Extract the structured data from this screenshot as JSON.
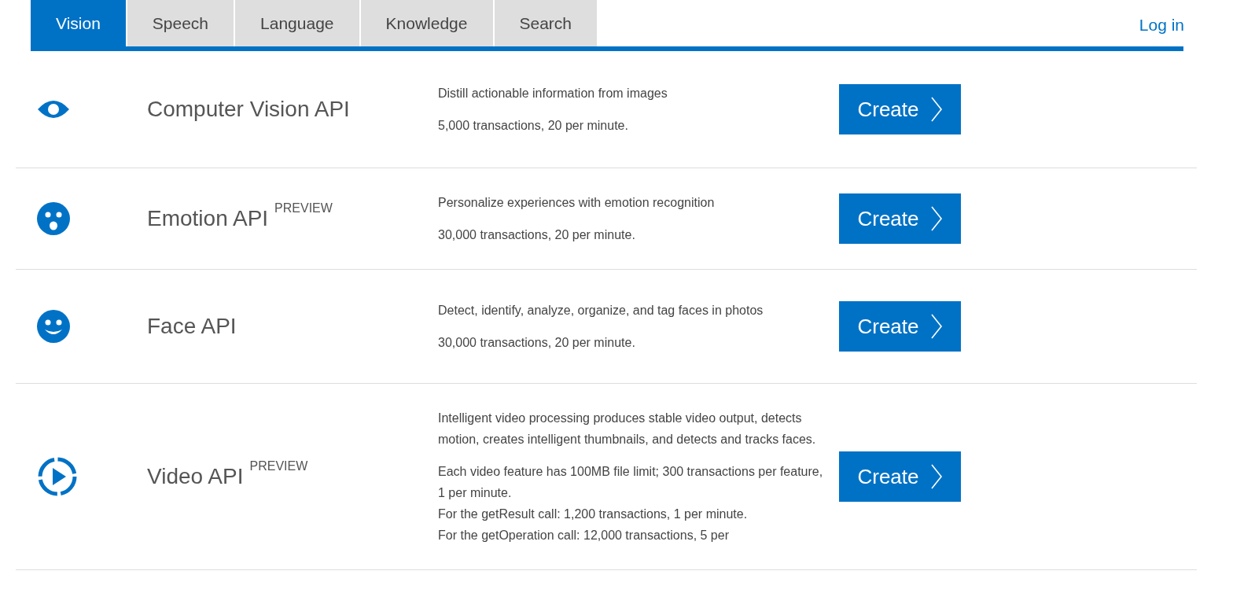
{
  "tabs": [
    {
      "label": "Vision",
      "selected": true
    },
    {
      "label": "Speech",
      "selected": false
    },
    {
      "label": "Language",
      "selected": false
    },
    {
      "label": "Knowledge",
      "selected": false
    },
    {
      "label": "Search",
      "selected": false
    }
  ],
  "login": "Log in",
  "apis": [
    {
      "kind": "eye",
      "name": "Computer Vision API",
      "description": "Distill actionable information from images",
      "limits": [
        "5,000 transactions, 20 per minute."
      ],
      "button": "Create"
    },
    {
      "kind": "emotion",
      "name": "Emotion API",
      "badge": "PREVIEW",
      "description": "Personalize experiences with emotion recognition",
      "limits": [
        "30,000 transactions, 20 per minute."
      ],
      "button": "Create"
    },
    {
      "kind": "face",
      "name": "Face API",
      "description": "Detect, identify, analyze, organize, and tag faces in photos",
      "limits": [
        "30,000 transactions, 20 per minute."
      ],
      "button": "Create"
    },
    {
      "kind": "video",
      "name": "Video API",
      "badge": "PREVIEW",
      "description": "Intelligent video processing produces stable video output, detects motion, creates intelligent thumbnails, and detects and tracks faces.",
      "limits": [
        "Each video feature has 100MB file limit; 300 transactions per feature, 1 per minute.",
        "For the getResult call: 1,200 transactions, 1 per minute.",
        "For the getOperation call: 12,000 transactions, 5 per"
      ],
      "button": "Create"
    }
  ]
}
